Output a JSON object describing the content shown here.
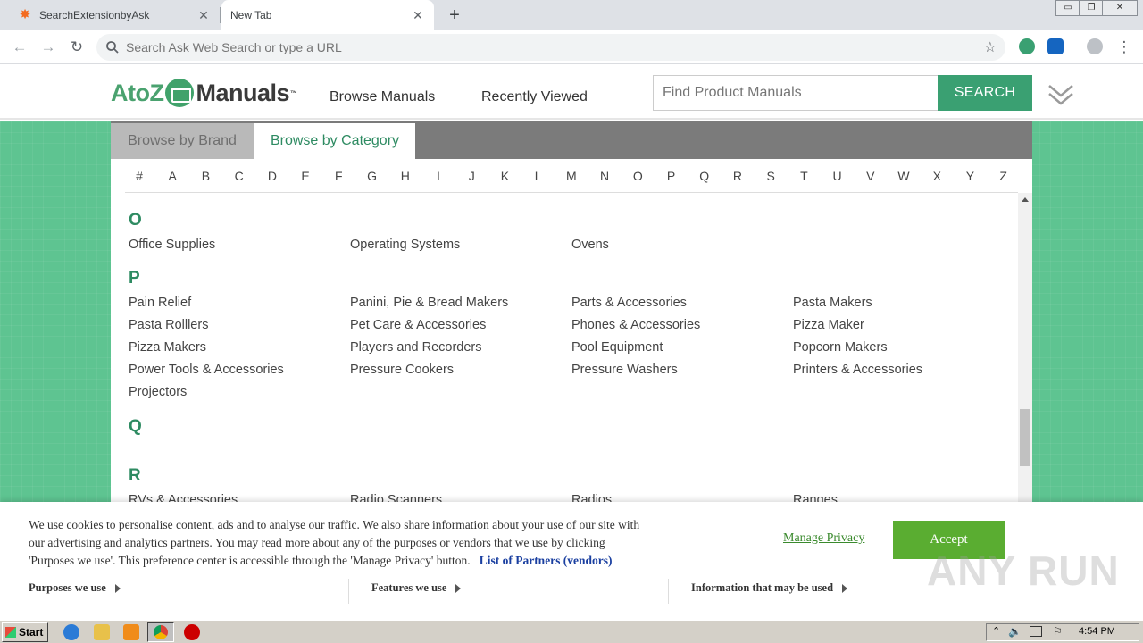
{
  "browser": {
    "tabs": [
      {
        "title": "SearchExtensionbyAsk",
        "active": false
      },
      {
        "title": "New Tab",
        "active": true
      }
    ],
    "new_tab_label": "+",
    "window_controls": {
      "minimize": "▭",
      "restore": "❐",
      "close": "✕"
    },
    "omnibox_placeholder": "Search Ask Web Search or type a URL"
  },
  "site": {
    "logo": {
      "part1": "AtoZ",
      "part2": "Manuals",
      "tm": "™"
    },
    "nav": {
      "browse": "Browse Manuals",
      "recent": "Recently Viewed"
    },
    "search": {
      "placeholder": "Find Product Manuals",
      "button": "SEARCH"
    },
    "browse_tabs": {
      "brand": "Browse by Brand",
      "category": "Browse by Category"
    },
    "letters": [
      "#",
      "A",
      "B",
      "C",
      "D",
      "E",
      "F",
      "G",
      "H",
      "I",
      "J",
      "K",
      "L",
      "M",
      "N",
      "O",
      "P",
      "Q",
      "R",
      "S",
      "T",
      "U",
      "V",
      "W",
      "X",
      "Y",
      "Z"
    ],
    "sections": [
      {
        "letter": "O",
        "items": [
          "Office Supplies",
          "Operating Systems",
          "Ovens"
        ]
      },
      {
        "letter": "P",
        "items": [
          "Pain Relief",
          "Panini, Pie & Bread Makers",
          "Parts & Accessories",
          "Pasta Makers",
          "Pasta Rolllers",
          "Pet Care & Accessories",
          "Phones & Accessories",
          "Pizza Maker",
          "Pizza Makers",
          "Players and Recorders",
          "Pool Equipment",
          "Popcorn Makers",
          "Power Tools & Accessories",
          "Pressure Cookers",
          "Pressure Washers",
          "Printers & Accessories",
          "Projectors"
        ]
      },
      {
        "letter": "Q",
        "items": []
      },
      {
        "letter": "R",
        "items": [
          "RVs & Accessories",
          "Radio Scanners",
          "Radios",
          "Ranges"
        ]
      }
    ]
  },
  "cookie": {
    "message_line1": "We use cookies to personalise content, ads and to analyse our traffic. We also share information about your use of our site with",
    "message_line2": "our advertising and analytics partners. You may read more about any of the purposes or vendors that we use by clicking",
    "message_line3": "'Purposes we use'. This preference center is accessible through the 'Manage Privacy' button.",
    "partners_link": "List of Partners (vendors)",
    "manage_privacy": "Manage Privacy",
    "accept": "Accept",
    "purposes": "Purposes we use",
    "features": "Features we use",
    "information": "Information that may be used",
    "watermark": "ANY RUN"
  },
  "taskbar": {
    "start": "Start",
    "clock": "4:54 PM"
  }
}
